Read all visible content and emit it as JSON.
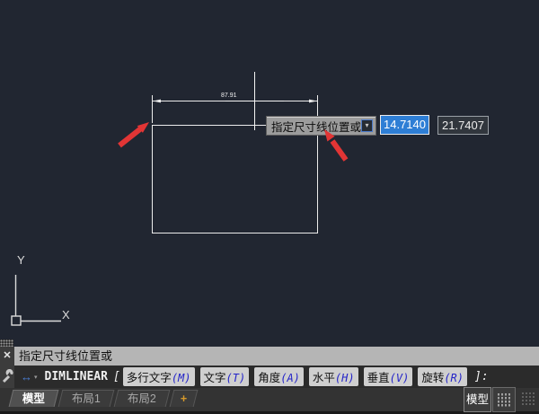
{
  "glyphs": {
    "close": "✕",
    "prompt_arrow": "↔",
    "prompt_arrow_caret": "▾",
    "expand_caret": "▾"
  },
  "canvas": {
    "dimension_text": "87.91",
    "tooltip_label": "指定尺寸线位置或",
    "pointer_input_x": "14.7140",
    "pointer_input_y": "21.7407",
    "ucs_x_label": "X",
    "ucs_y_label": "Y"
  },
  "command": {
    "history_line": "指定尺寸线位置或",
    "name": "DIMLINEAR",
    "bracket_open": "[",
    "options": [
      {
        "label": "多行文字",
        "key": "(M)"
      },
      {
        "label": "文字",
        "key": "(T)"
      },
      {
        "label": "角度",
        "key": "(A)"
      },
      {
        "label": "水平",
        "key": "(H)"
      },
      {
        "label": "垂直",
        "key": "(V)"
      },
      {
        "label": "旋转",
        "key": "(R)"
      }
    ],
    "bracket_close": "]:"
  },
  "tabs": {
    "model": "模型",
    "layout1": "布局1",
    "layout2": "布局2",
    "add_label": "+"
  },
  "statusbar": {
    "model_toggle": "模型"
  },
  "colors": {
    "canvas_bg": "#212631",
    "geometry_line": "#ececec",
    "arrow_red": "#e23535",
    "selection_blue": "#2e7ed5",
    "option_key_blue": "#2424c8",
    "tooltip_bg": "#9c9c9c"
  }
}
